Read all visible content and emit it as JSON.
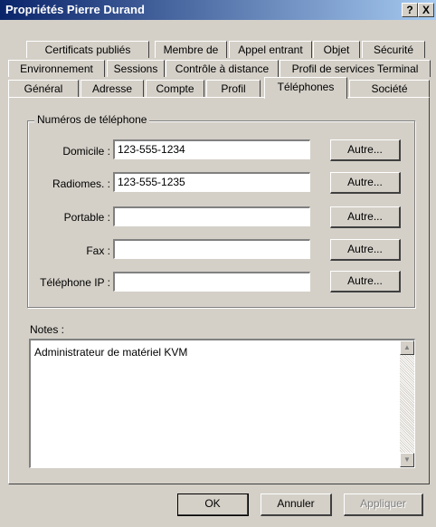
{
  "window": {
    "title": "Propriétés Pierre Durand",
    "help_btn": "?",
    "close_btn": "X"
  },
  "tabs_row1": [
    "Certificats publiés",
    "Membre de",
    "Appel entrant",
    "Objet",
    "Sécurité"
  ],
  "tabs_row2": [
    "Environnement",
    "Sessions",
    "Contrôle à distance",
    "Profil de services Terminal"
  ],
  "tabs_row3": [
    "Général",
    "Adresse",
    "Compte",
    "Profil",
    "Téléphones",
    "Société"
  ],
  "group_label": "Numéros de téléphone",
  "phones": [
    {
      "label": "Domicile :",
      "value": "123-555-1234",
      "button": "Autre..."
    },
    {
      "label": "Radiomes. :",
      "value": "123-555-1235",
      "button": "Autre..."
    },
    {
      "label": "Portable :",
      "value": "",
      "button": "Autre..."
    },
    {
      "label": "Fax :",
      "value": "",
      "button": "Autre..."
    },
    {
      "label": "Téléphone IP :",
      "value": "",
      "button": "Autre..."
    }
  ],
  "notes_label": "Notes :",
  "notes_value": "Administrateur de matériel KVM",
  "footer": {
    "ok": "OK",
    "cancel": "Annuler",
    "apply": "Appliquer"
  }
}
